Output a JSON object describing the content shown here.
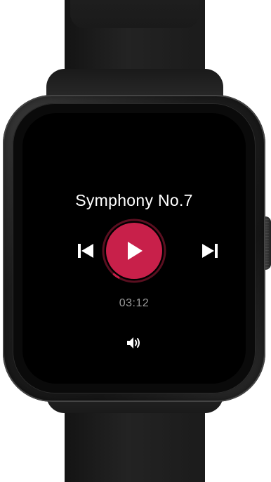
{
  "now_playing": {
    "title": "Symphony No.7",
    "elapsed": "03:12",
    "progress": 0.03
  },
  "controls": {
    "previous_icon": "skip-previous-icon",
    "play_icon": "play-icon",
    "next_icon": "skip-next-icon",
    "volume_icon": "volume-icon"
  },
  "colors": {
    "accent": "#c8204a",
    "progress_track": "#5a0f20",
    "screen_background": "#000000",
    "title_text": "#ffffff",
    "time_text": "#9a9a9a"
  }
}
